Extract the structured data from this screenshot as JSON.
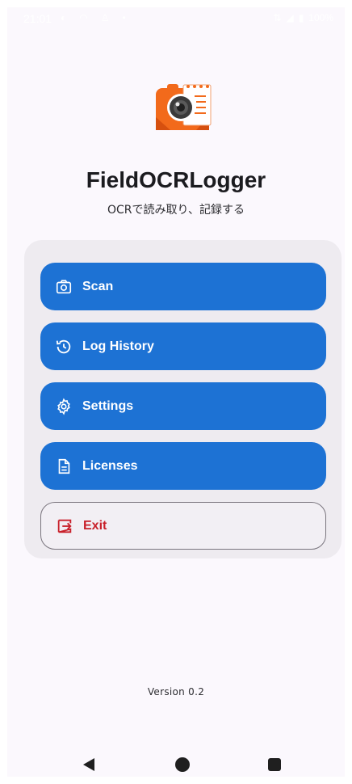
{
  "status_bar": {
    "time": "21:01",
    "battery": "100%",
    "left_icons": [
      "moon-icon",
      "wifi-icon",
      "person-icon",
      "dot-icon"
    ],
    "right_icons": [
      "data-arrows-icon",
      "signal-icon",
      "battery-icon"
    ]
  },
  "app": {
    "title": "FieldOCRLogger",
    "subtitle": "OCRで読み取り、記録する",
    "logo_icon": "camera-notepad-logo"
  },
  "menu": {
    "items": [
      {
        "label": "Scan",
        "icon": "camera-icon"
      },
      {
        "label": "Log History",
        "icon": "history-icon"
      },
      {
        "label": "Settings",
        "icon": "gear-icon"
      },
      {
        "label": "Licenses",
        "icon": "document-icon"
      },
      {
        "label": "Exit",
        "icon": "exit-icon"
      }
    ]
  },
  "footer": {
    "version": "Version 0.2"
  },
  "colors": {
    "primary": "#1d72d4",
    "danger": "#c8202a",
    "card_bg": "#eeebf0",
    "screen_bg": "#fbf8fd",
    "logo_orange": "#f26a1b"
  },
  "navigation": [
    "back-icon",
    "home-icon",
    "recents-icon"
  ]
}
